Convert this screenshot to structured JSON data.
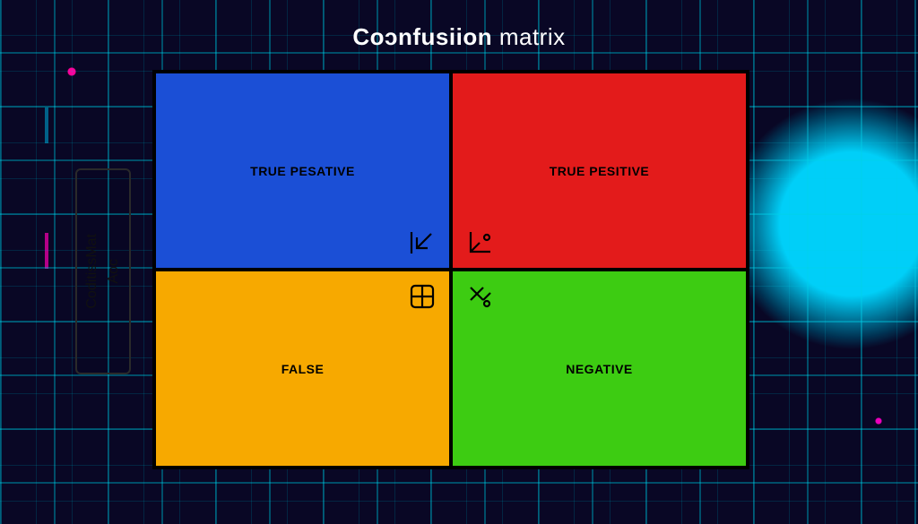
{
  "title": {
    "bold": "Coɔnfusiion",
    "thin": "matrix"
  },
  "yaxis": {
    "line1": "CoditissMat",
    "line2": "Aoc"
  },
  "cells": {
    "top_left": {
      "label": "TRUE PESATIVE",
      "color": "#1b4fd6",
      "icon": "arrow-in-down-left-icon"
    },
    "top_right": {
      "label": "TRUE PESITIVE",
      "color": "#e31b1b",
      "icon": "axis-dot-icon"
    },
    "bottom_left": {
      "label": "FALSE",
      "color": "#f7a900",
      "icon": "grid-2x2-icon"
    },
    "bottom_right": {
      "label": "NEGATIVE",
      "color": "#3dcc12",
      "icon": "scissors-arrow-icon"
    }
  }
}
